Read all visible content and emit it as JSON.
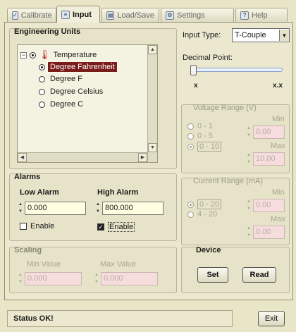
{
  "tabs": [
    {
      "label": "Calibrate",
      "icon": "calibrate-icon",
      "active": false
    },
    {
      "label": "Input",
      "icon": "input-icon",
      "active": true
    },
    {
      "label": "Load/Save",
      "icon": "load-save-icon",
      "active": false
    },
    {
      "label": "Settings",
      "icon": "settings-icon",
      "active": false
    },
    {
      "label": "Help",
      "icon": "help-icon",
      "active": false
    }
  ],
  "engineering_units": {
    "title": "Engineering Units",
    "root": "Temperature",
    "items": [
      "Degree Fahrenheit",
      "Degree F",
      "Degree Celsius",
      "Degree C"
    ],
    "selected_index": 0
  },
  "input_type": {
    "label": "Input Type:",
    "value": "T-Couple"
  },
  "decimal_point": {
    "label": "Decimal Point:",
    "min_label": "x",
    "max_label": "x.x",
    "level": 0
  },
  "voltage_range": {
    "title": "Voltage Range (V)",
    "options": [
      "0 - 1",
      "0 - 5",
      "0 - 10"
    ],
    "selected_index": 2,
    "min_label": "Min",
    "min_value": "0.00",
    "max_label": "Max",
    "max_value": "10.00"
  },
  "current_range": {
    "title": "Current Range (mA)",
    "options": [
      "0 - 20",
      "4 - 20"
    ],
    "selected_index": 0,
    "min_label": "Min",
    "min_value": "0.00",
    "max_label": "Max",
    "max_value": "0.00"
  },
  "alarms": {
    "title": "Alarms",
    "low_label": "Low Alarm",
    "low_value": "0.000",
    "low_enable_label": "Enable",
    "low_enabled": false,
    "high_label": "High Alarm",
    "high_value": "800.000",
    "high_enable_label": "Enable",
    "high_enabled": true
  },
  "scaling": {
    "title": "Scaling",
    "min_label": "Min Value",
    "min_value": "0.000",
    "max_label": "Max Value",
    "max_value": "0.000"
  },
  "device": {
    "title": "Device",
    "set_label": "Set",
    "read_label": "Read"
  },
  "status": {
    "text": "Status OK!"
  },
  "exit_label": "Exit",
  "colors": {
    "selection": "#7b1c1c",
    "panel": "#ebe8cf",
    "input_bg": "#fffee0",
    "disabled_input": "#f6dcdc"
  }
}
